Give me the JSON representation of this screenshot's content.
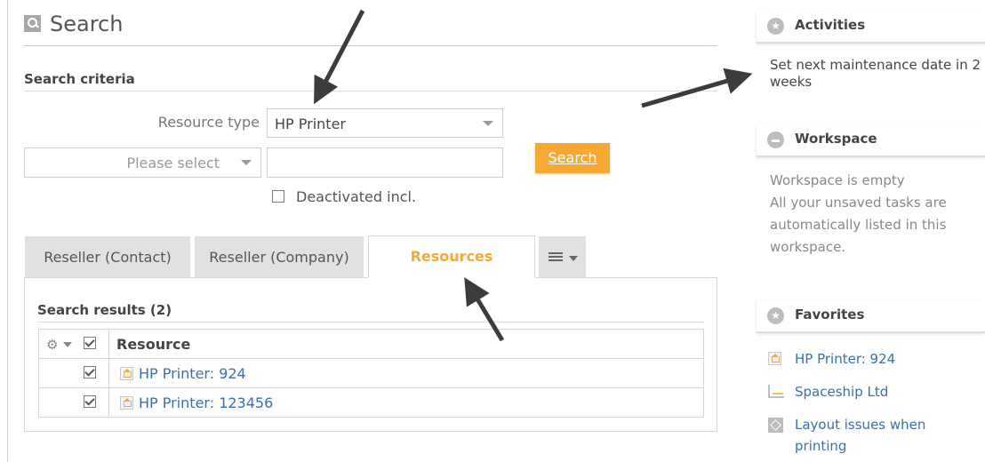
{
  "header": {
    "title": "Search",
    "icon": "search-icon"
  },
  "criteria": {
    "title": "Search criteria",
    "resource_type_label": "Resource type",
    "resource_type_value": "HP Printer",
    "field_select_value": "Please select",
    "search_input_value": "",
    "search_button": "Search",
    "deactivated_label": "Deactivated incl.",
    "deactivated_checked": false
  },
  "tabs": [
    {
      "label": "Reseller (Contact)",
      "active": false
    },
    {
      "label": "Reseller (Company)",
      "active": false
    },
    {
      "label": "Resources",
      "active": true
    },
    {
      "label": "",
      "icon": "list-menu-icon",
      "active": false
    }
  ],
  "results": {
    "title": "Search results (2)",
    "column": "Resource",
    "rows": [
      {
        "label": "HP Printer: 924",
        "checked": true
      },
      {
        "label": "HP Printer: 123456",
        "checked": true
      }
    ]
  },
  "sidebar": {
    "activities": {
      "title": "Activities",
      "text": "Set next maintenance date in 2 weeks"
    },
    "workspace": {
      "title": "Workspace",
      "line1": "Workspace is empty",
      "line2": "All your unsaved tasks are automatically listed in this workspace."
    },
    "favorites": {
      "title": "Favorites",
      "items": [
        {
          "label": "HP Printer: 924",
          "icon": "resource-icon"
        },
        {
          "label": "Spaceship Ltd",
          "icon": "company-chart-icon"
        },
        {
          "label": "Layout issues when printing",
          "icon": "issue-icon"
        }
      ]
    }
  },
  "colors": {
    "accent": "#f7a934",
    "link": "#3a6fb0",
    "annotation_arrow": "#3c3c3c"
  }
}
